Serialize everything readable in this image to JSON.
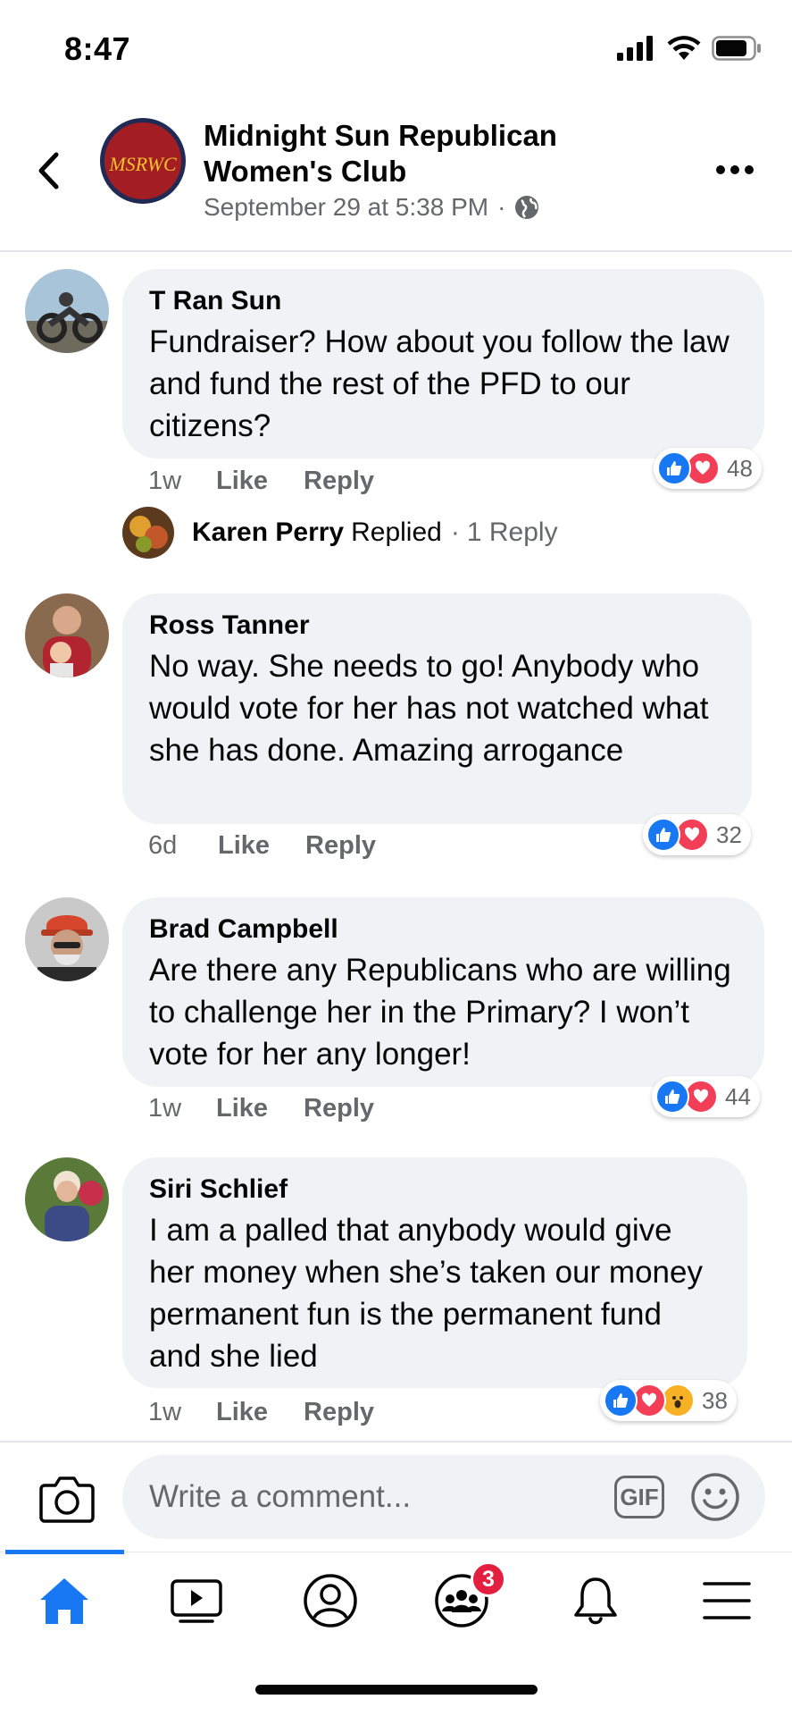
{
  "status_bar": {
    "time": "8:47"
  },
  "header": {
    "page_name": "Midnight Sun Republican Women's Club",
    "avatar_text": "MSRWC",
    "post_time": "September 29 at 5:38 PM",
    "separator": "·",
    "audience_icon": "globe-icon"
  },
  "comments": [
    {
      "author": "T Ran Sun",
      "text": "Fundraiser? How about you follow the law and fund the rest of the PFD to our citizens?",
      "time": "1w",
      "like_label": "Like",
      "reply_label": "Reply",
      "reactions": [
        "like",
        "love"
      ],
      "reaction_count": "48",
      "replies": {
        "name": "Karen Perry",
        "replied_label": "Replied",
        "separator": "·",
        "count_label": "1 Reply"
      }
    },
    {
      "author": "Ross Tanner",
      "text": "No way. She needs to go! Anybody who would vote for her has not watched what she has done. Amazing arrogance",
      "time": "6d",
      "like_label": "Like",
      "reply_label": "Reply",
      "reactions": [
        "like",
        "love"
      ],
      "reaction_count": "32"
    },
    {
      "author": "Brad Campbell",
      "text": "Are there any Republicans who are willing to challenge her in the Primary? I won’t vote for her any longer!",
      "time": "1w",
      "like_label": "Like",
      "reply_label": "Reply",
      "reactions": [
        "like",
        "love"
      ],
      "reaction_count": "44"
    },
    {
      "author": "Siri Schlief",
      "text": "I am a palled that anybody would give her money when she’s taken our money permanent fun is the permanent fund and she lied",
      "time": "1w",
      "like_label": "Like",
      "reply_label": "Reply",
      "reactions": [
        "like",
        "love",
        "wow"
      ],
      "reaction_count": "38"
    }
  ],
  "composer": {
    "placeholder": "Write a comment...",
    "gif_label": "GIF"
  },
  "tabbar": {
    "active": "home",
    "groups_badge": "3"
  },
  "colors": {
    "accent": "#1877f2",
    "bubble": "#f0f2f5",
    "secondary_text": "#65676b",
    "love": "#f33e58",
    "badge": "#e41e3f"
  }
}
